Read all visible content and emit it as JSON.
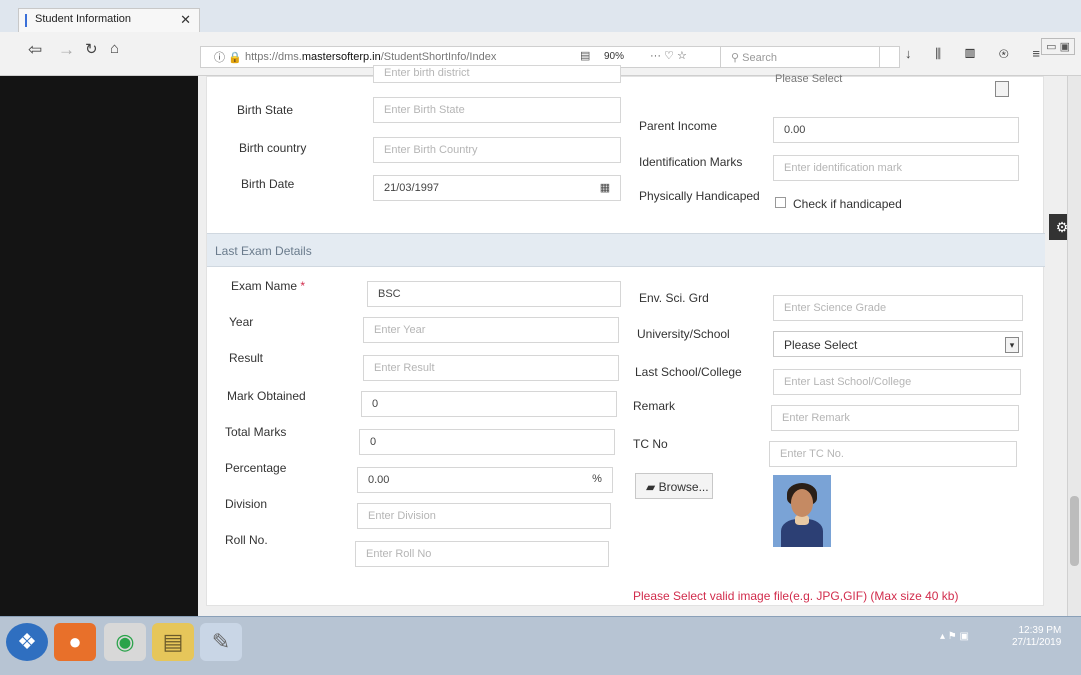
{
  "browser": {
    "tab_title": "Student Information",
    "tab_close": "✕",
    "url_prefix": "https://dms.",
    "url_domain": "mastersofterp.in",
    "url_path": "/StudentShortInfo/Index",
    "zoom": "90%",
    "search_placeholder": "Search"
  },
  "personal": {
    "birth_state_label": "Birth State",
    "birth_state_placeholder": "Enter Birth State",
    "birth_country_label": "Birth country",
    "birth_country_placeholder": "Enter Birth Country",
    "birth_date_label": "Birth Date",
    "birth_date_value": "21/03/1997",
    "top_partial_placeholder": "Enter birth district",
    "top_right_select": "Please Select",
    "parent_income_label": "Parent Income",
    "parent_income_value": "0.00",
    "identification_label": "Identification Marks",
    "identification_placeholder": "Enter identification mark",
    "handicap_label": "Physically Handicaped",
    "handicap_checkbox_label": "Check if handicaped"
  },
  "section_title": "Last Exam Details",
  "exam": {
    "exam_name_label": "Exam Name",
    "required_mark": "*",
    "exam_name_value": "BSC",
    "year_label": "Year",
    "year_placeholder": "Enter Year",
    "result_label": "Result",
    "result_placeholder": "Enter Result",
    "mark_obtained_label": "Mark Obtained",
    "mark_obtained_value": "0",
    "total_marks_label": "Total Marks",
    "total_marks_value": "0",
    "percentage_label": "Percentage",
    "percentage_value": "0.00",
    "percent_symbol": "%",
    "division_label": "Division",
    "division_placeholder": "Enter Division",
    "roll_no_label": "Roll No.",
    "roll_no_placeholder": "Enter Roll No",
    "env_sci_label": "Env. Sci. Grd",
    "env_sci_placeholder": "Enter Science Grade",
    "university_label": "University/School",
    "university_select": "Please Select",
    "last_school_label": "Last School/College",
    "last_school_placeholder": "Enter Last School/College",
    "remark_label": "Remark",
    "remark_placeholder": "Enter Remark",
    "tc_no_label": "TC No",
    "tc_no_placeholder": "Enter TC No.",
    "browse_label": "Browse...",
    "image_hint": "Please Select valid image file(e.g. JPG,GIF) (Max size 40 kb)"
  },
  "taskbar": {
    "time": "12:39 PM",
    "date": "27/11/2019"
  }
}
